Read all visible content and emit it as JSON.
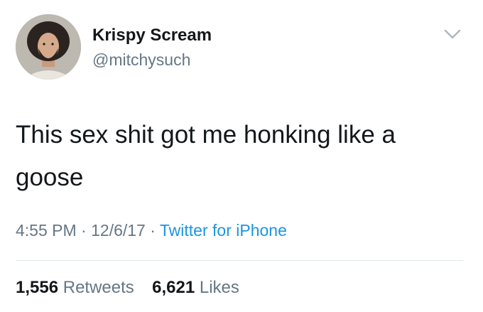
{
  "author": {
    "display_name": "Krispy Scream",
    "handle": "@mitchysuch"
  },
  "tweet": {
    "text": "This sex shit got me honking like a goose",
    "time": "4:55 PM",
    "date": "12/6/17",
    "source": "Twitter for iPhone"
  },
  "stats": {
    "retweets_count": "1,556",
    "retweets_label": "Retweets",
    "likes_count": "6,621",
    "likes_label": "Likes"
  },
  "icons": {
    "menu": "chevron-down-icon"
  },
  "colors": {
    "text_primary": "#14171a",
    "text_secondary": "#657786",
    "link": "#1b95e0",
    "divider": "#e1e8ed"
  }
}
